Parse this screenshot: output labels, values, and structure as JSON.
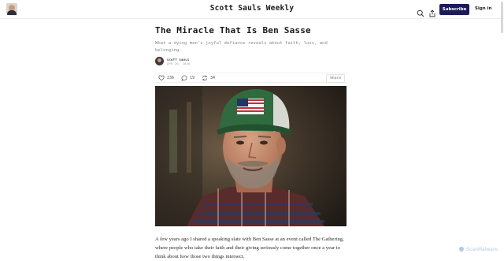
{
  "header": {
    "publication": "Scott Sauls Weekly",
    "subscribe_label": "Subscribe",
    "signin_label": "Sign in"
  },
  "post": {
    "title": "The Miracle That Is Ben Sasse",
    "subtitle": "What a dying man's joyful defiance reveals about faith, loss, and belonging.",
    "author": "SCOTT SAULS",
    "date": "APR 20, 2026",
    "likes": "236",
    "comments": "19",
    "restacks": "34",
    "share_label": "Share",
    "body": "A few years ago I shared a speaking slate with Ben Sasse at an event called The Gathering, where people who take their faith and their giving seriously come together once a year to think about how those two things intersect."
  },
  "watermark": "ScanMalware",
  "icons": [
    "search-icon",
    "share-icon",
    "heart-icon",
    "comment-icon",
    "restack-icon"
  ]
}
